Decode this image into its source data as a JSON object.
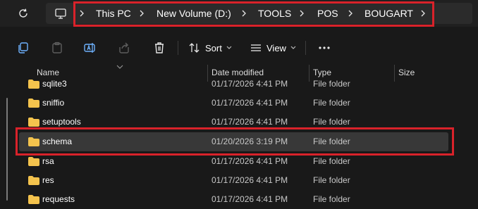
{
  "breadcrumb": {
    "items": [
      "This PC",
      "New Volume (D:)",
      "TOOLS",
      "POS",
      "BOUGART"
    ]
  },
  "toolbar": {
    "sort_label": "Sort",
    "view_label": "View"
  },
  "columns": {
    "name": "Name",
    "date": "Date modified",
    "type": "Type",
    "size": "Size"
  },
  "rows": [
    {
      "name": "sqlite3",
      "date": "01/17/2026 4:41 PM",
      "type": "File folder"
    },
    {
      "name": "sniffio",
      "date": "01/17/2026 4:41 PM",
      "type": "File folder"
    },
    {
      "name": "setuptools",
      "date": "01/17/2026 4:41 PM",
      "type": "File folder"
    },
    {
      "name": "schema",
      "date": "01/20/2026 3:19 PM",
      "type": "File folder"
    },
    {
      "name": "rsa",
      "date": "01/17/2026 4:41 PM",
      "type": "File folder"
    },
    {
      "name": "res",
      "date": "01/17/2026 4:41 PM",
      "type": "File folder"
    },
    {
      "name": "requests",
      "date": "01/17/2026 4:41 PM",
      "type": "File folder"
    }
  ],
  "colors": {
    "highlight": "#d9222a",
    "folder": "#f4c34d",
    "selected_row": "#383838"
  }
}
